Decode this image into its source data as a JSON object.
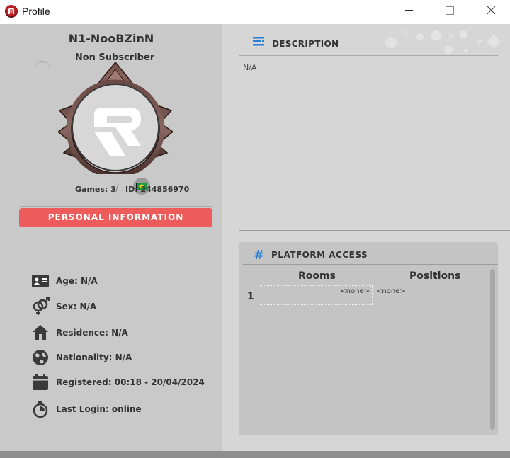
{
  "window": {
    "title": "Profile",
    "icon": "app-logo-icon"
  },
  "profile": {
    "name": "N1-NooBZinN",
    "subscription": "Non Subscriber",
    "games": "Games: 3",
    "separator": "/",
    "id": "ID: 244856970",
    "country_flag": "brazil-flag-icon"
  },
  "personal_info": {
    "button_label": "PERSONAL INFORMATION",
    "items": [
      {
        "icon": "id-card-icon",
        "text": "Age: N/A"
      },
      {
        "icon": "gender-icon",
        "text": "Sex: N/A"
      },
      {
        "icon": "house-icon",
        "text": "Residence: N/A"
      },
      {
        "icon": "globe-icon",
        "text": "Nationality: N/A"
      },
      {
        "icon": "calendar-icon",
        "text": "Registered: 00:18 - 20/04/2024"
      },
      {
        "icon": "stopwatch-icon",
        "text": "Last Login: online"
      }
    ]
  },
  "description": {
    "title": "DESCRIPTION",
    "text": "N/A"
  },
  "platform_access": {
    "title": "PLATFORM ACCESS",
    "icon": "#",
    "columns": [
      "Rooms",
      "Positions"
    ],
    "rows": [
      {
        "index": "1",
        "room": "<none>",
        "position": "<none>"
      }
    ]
  },
  "colors": {
    "accent_red": "#ee5b5b",
    "accent_blue": "#2a7fd4",
    "panel_left": "#c9c9c9",
    "panel_right": "#d6d6d6"
  }
}
